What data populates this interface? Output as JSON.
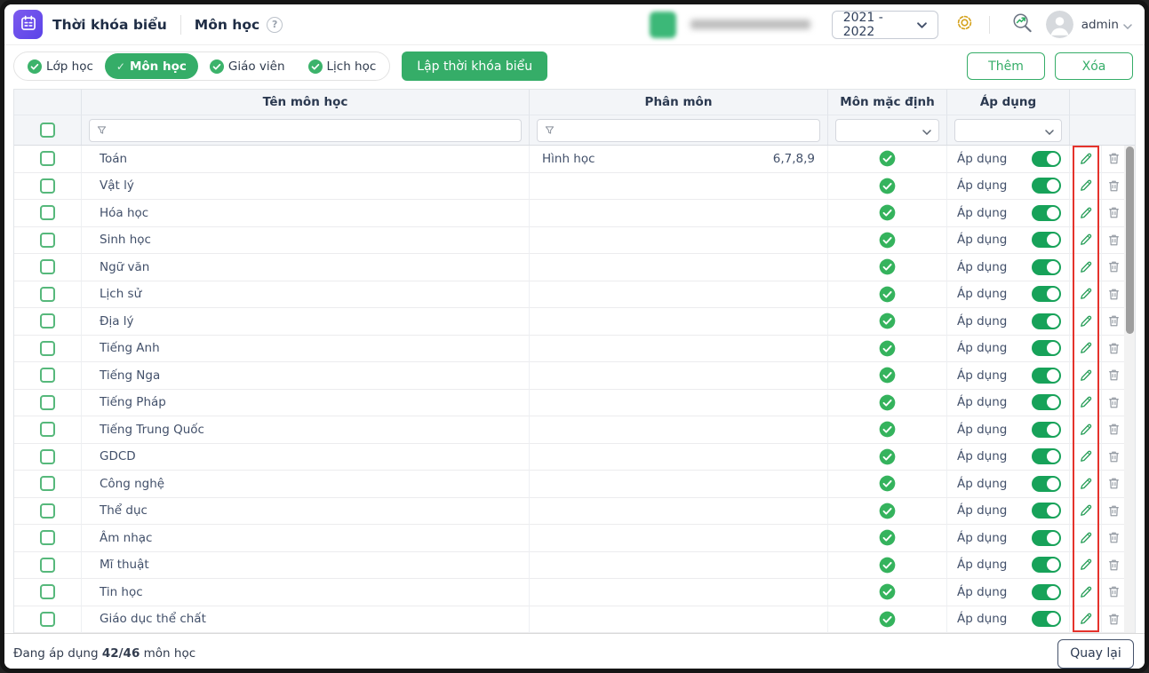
{
  "header": {
    "app_title": "Thời khóa biểu",
    "page_title": "Môn học",
    "school_year": "2021 - 2022",
    "username": "admin"
  },
  "toolbar": {
    "tabs": [
      {
        "label": "Lớp học",
        "active": false
      },
      {
        "label": "Môn học",
        "active": true
      },
      {
        "label": "Giáo viên",
        "active": false
      },
      {
        "label": "Lịch học",
        "active": false
      }
    ],
    "schedule_button": "Lập thời khóa biểu",
    "add_button": "Thêm",
    "delete_button": "Xóa"
  },
  "table": {
    "columns": [
      "Tên môn học",
      "Phân môn",
      "Môn mặc định",
      "Áp dụng"
    ],
    "apply_label": "Áp dụng",
    "rows": [
      {
        "name": "Toán",
        "submodule": "Hình học",
        "grades": "6,7,8,9"
      },
      {
        "name": "Vật lý",
        "submodule": "",
        "grades": ""
      },
      {
        "name": "Hóa học",
        "submodule": "",
        "grades": ""
      },
      {
        "name": "Sinh học",
        "submodule": "",
        "grades": ""
      },
      {
        "name": "Ngữ văn",
        "submodule": "",
        "grades": ""
      },
      {
        "name": "Lịch sử",
        "submodule": "",
        "grades": ""
      },
      {
        "name": "Địa lý",
        "submodule": "",
        "grades": ""
      },
      {
        "name": "Tiếng Anh",
        "submodule": "",
        "grades": ""
      },
      {
        "name": "Tiếng Nga",
        "submodule": "",
        "grades": ""
      },
      {
        "name": "Tiếng Pháp",
        "submodule": "",
        "grades": ""
      },
      {
        "name": "Tiếng Trung Quốc",
        "submodule": "",
        "grades": ""
      },
      {
        "name": "GDCD",
        "submodule": "",
        "grades": ""
      },
      {
        "name": "Công nghệ",
        "submodule": "",
        "grades": ""
      },
      {
        "name": "Thể dục",
        "submodule": "",
        "grades": ""
      },
      {
        "name": "Âm nhạc",
        "submodule": "",
        "grades": ""
      },
      {
        "name": "Mĩ thuật",
        "submodule": "",
        "grades": ""
      },
      {
        "name": "Tin học",
        "submodule": "",
        "grades": ""
      },
      {
        "name": "Giáo dục thể chất",
        "submodule": "",
        "grades": ""
      }
    ]
  },
  "footer": {
    "status_prefix": "Đang áp dụng ",
    "status_count": "42/46",
    "status_suffix": " môn học",
    "back_button": "Quay lại"
  },
  "colors": {
    "accent_green": "#35ad68",
    "toggle_green": "#17a259",
    "check_green": "#35b35d",
    "highlight_red": "#e5332c",
    "logo_purple": "#6a4fec",
    "gear_gold": "#d5a21c"
  }
}
